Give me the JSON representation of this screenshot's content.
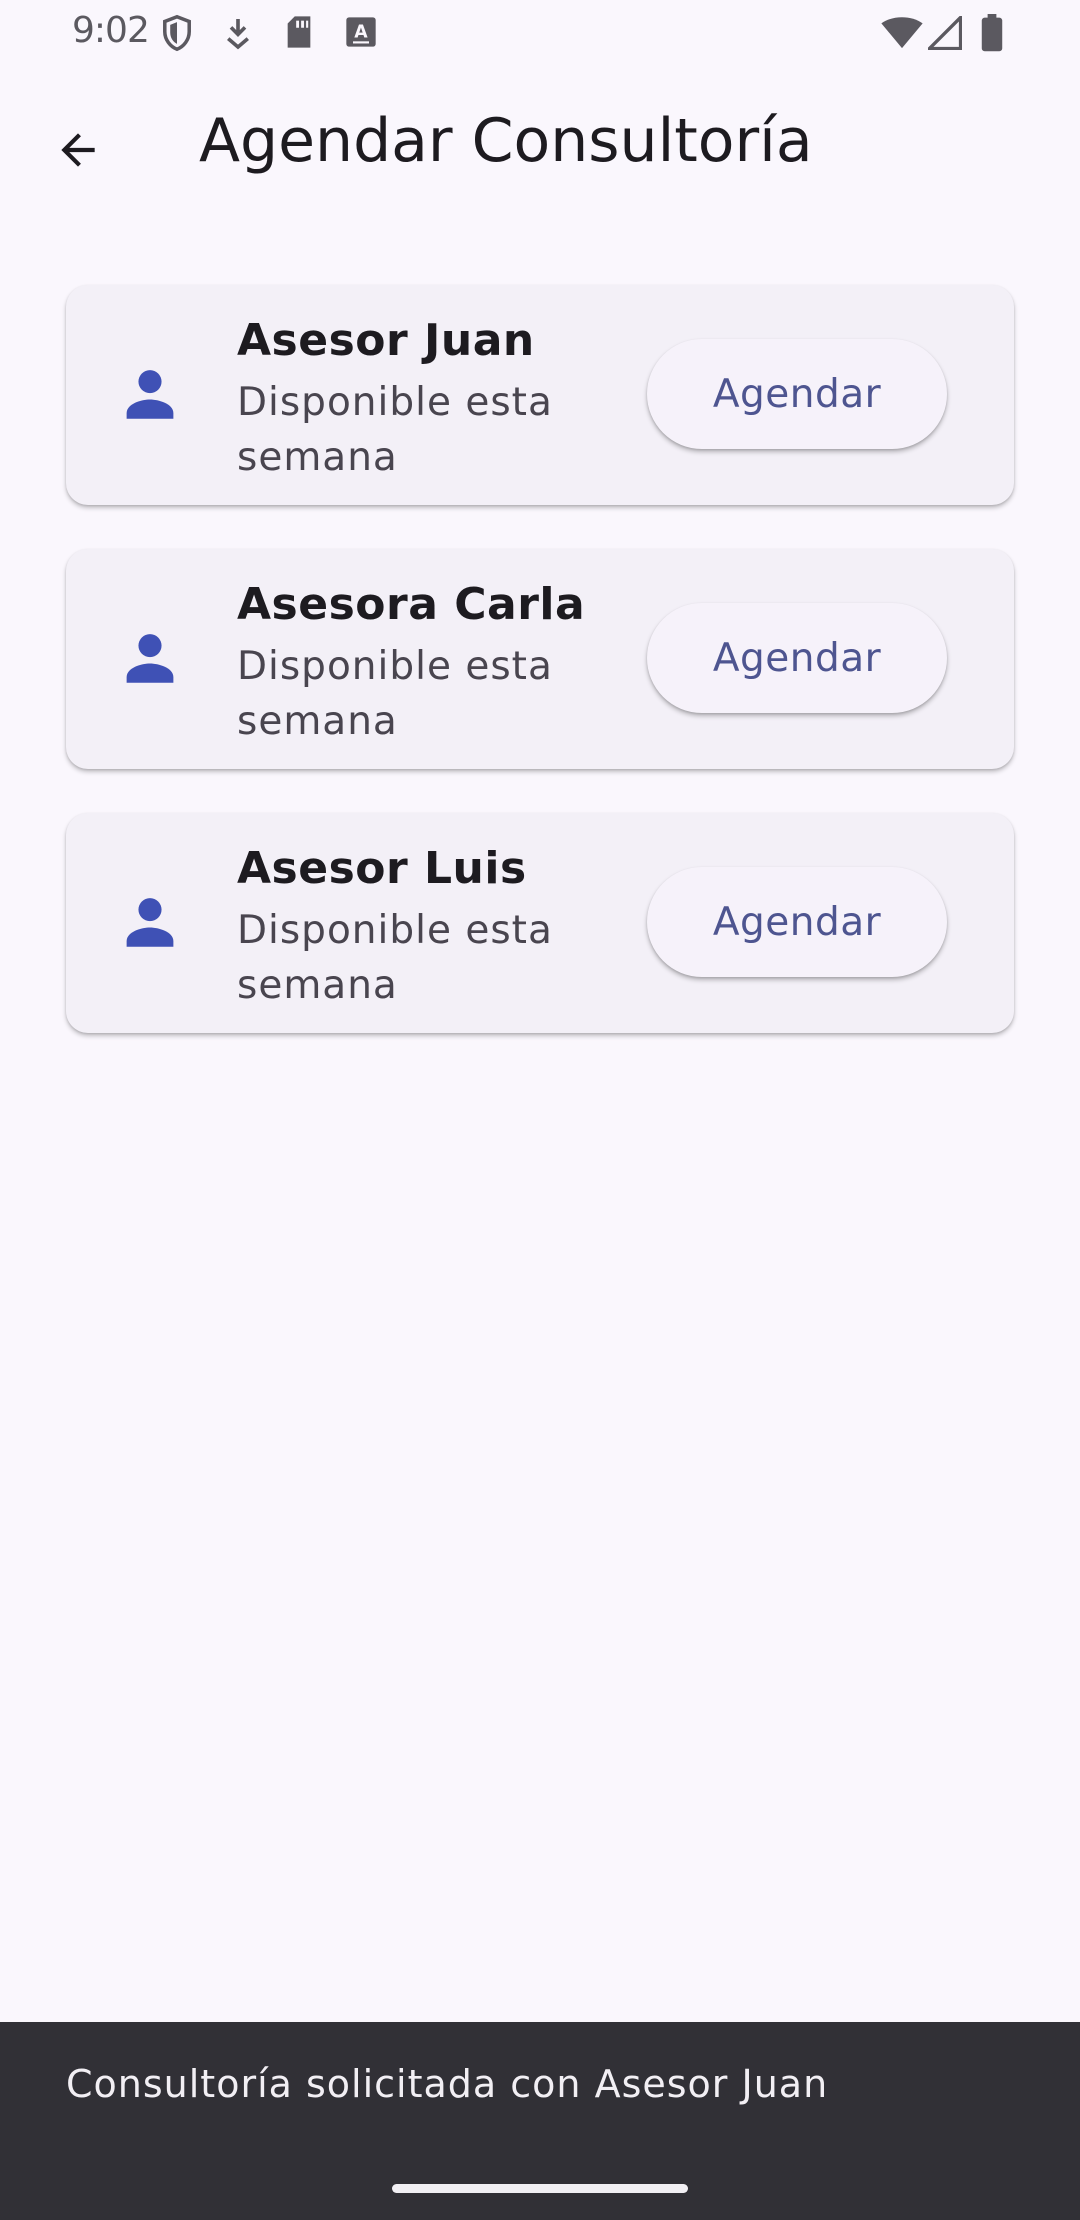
{
  "status_bar": {
    "time": "9:02",
    "left_icons": [
      "shield-icon",
      "download-icon",
      "sd-card-icon",
      "text-icon"
    ],
    "right_icons": [
      "wifi-icon",
      "cell-signal-icon",
      "battery-icon"
    ]
  },
  "app_bar": {
    "title": "Agendar Consultoría",
    "back_icon": "arrow-back-icon"
  },
  "advisors": [
    {
      "name": "Asesor Juan",
      "status": "Disponible esta semana",
      "button": "Agendar",
      "icon": "person-icon"
    },
    {
      "name": "Asesora Carla",
      "status": "Disponible esta semana",
      "button": "Agendar",
      "icon": "person-icon"
    },
    {
      "name": "Asesor Luis",
      "status": "Disponible esta semana",
      "button": "Agendar",
      "icon": "person-icon"
    }
  ],
  "snackbar": {
    "message": "Consultoría solicitada con Asesor Juan"
  },
  "colors": {
    "background": "#faf7fd",
    "card": "#f3f0f7",
    "accent_icon": "#3f51b5",
    "button_text": "#4e5590",
    "snackbar": "#313036"
  }
}
